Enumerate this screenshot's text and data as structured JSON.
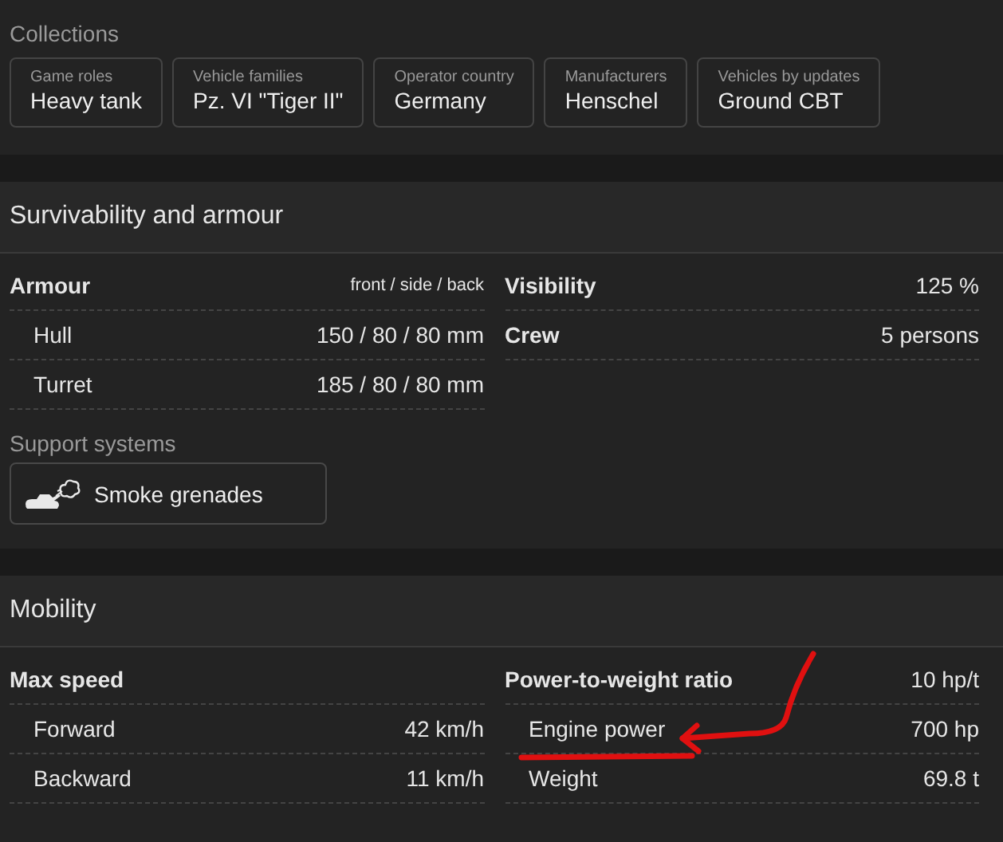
{
  "collections": {
    "title": "Collections",
    "items": [
      {
        "label": "Game roles",
        "value": "Heavy tank"
      },
      {
        "label": "Vehicle families",
        "value": "Pz. VI \"Tiger II\""
      },
      {
        "label": "Operator country",
        "value": "Germany"
      },
      {
        "label": "Manufacturers",
        "value": "Henschel"
      },
      {
        "label": "Vehicles by updates",
        "value": "Ground CBT"
      }
    ]
  },
  "sections": [
    {
      "title": "Survivability and armour",
      "columns": [
        [
          {
            "kind": "header",
            "label": "Armour",
            "value": "front / side / back"
          },
          {
            "kind": "sub",
            "label": "Hull",
            "value": "150 / 80 / 80 mm"
          },
          {
            "kind": "sub",
            "label": "Turret",
            "value": "185 / 80 / 80 mm"
          }
        ],
        [
          {
            "kind": "header",
            "label": "Visibility",
            "value": "125 %"
          },
          {
            "kind": "header",
            "label": "Crew",
            "value": "5 persons"
          }
        ]
      ],
      "support": {
        "title": "Support systems",
        "items": [
          {
            "label": "Smoke grenades"
          }
        ]
      }
    },
    {
      "title": "Mobility",
      "columns": [
        [
          {
            "kind": "header",
            "label": "Max speed"
          },
          {
            "kind": "sub",
            "label": "Forward",
            "value": "42 km/h"
          },
          {
            "kind": "sub",
            "label": "Backward",
            "value": "11 km/h"
          }
        ],
        [
          {
            "kind": "header",
            "label": "Power-to-weight ratio",
            "value": "10 hp/t"
          },
          {
            "kind": "sub",
            "label": "Engine power",
            "value": "700 hp"
          },
          {
            "kind": "sub",
            "label": "Weight",
            "value": "69.8 t"
          }
        ]
      ]
    }
  ]
}
